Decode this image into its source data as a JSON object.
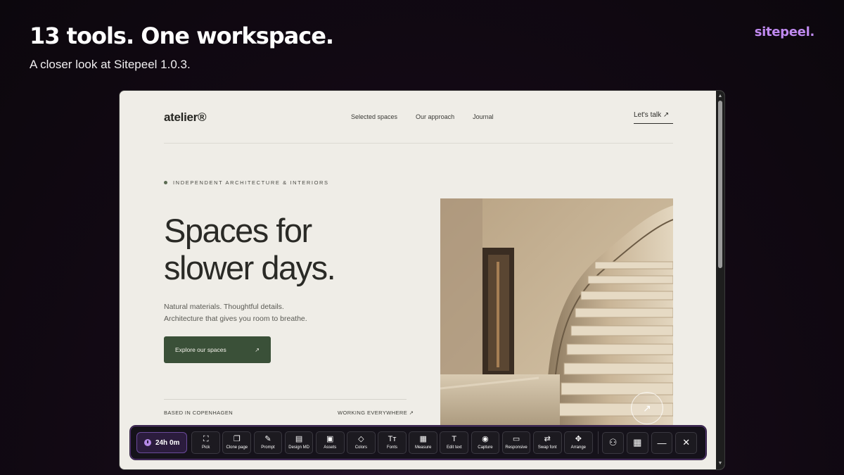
{
  "header": {
    "headline": "13 tools. One workspace.",
    "subline": "A closer look at Sitepeel 1.0.3.",
    "brand": "sitepeel."
  },
  "site": {
    "logo": "atelier®",
    "nav": [
      "Selected spaces",
      "Our approach",
      "Journal"
    ],
    "talk_link": "Let's talk ↗",
    "eyebrow": "INDEPENDENT ARCHITECTURE & INTERIORS",
    "hero_title": "Spaces for slower days.",
    "hero_text_1": "Natural materials. Thoughtful details.",
    "hero_text_2": "Architecture that gives you room to breathe.",
    "cta_label": "Explore our spaces",
    "cta_arrow": "↗",
    "footer_left": "BASED IN COPENHAGEN",
    "footer_right": "WORKING EVERYWHERE ↗",
    "image_button": "↗"
  },
  "toolbar": {
    "timer": "24h 0m",
    "tools": [
      {
        "label": "Pick",
        "icon": "⛶"
      },
      {
        "label": "Clone page",
        "icon": "❐"
      },
      {
        "label": "Prompt",
        "icon": "✎"
      },
      {
        "label": "Design MD",
        "icon": "▤"
      },
      {
        "label": "Assets",
        "icon": "▣"
      },
      {
        "label": "Colors",
        "icon": "◇"
      },
      {
        "label": "Fonts",
        "icon": "Tт"
      },
      {
        "label": "Measure",
        "icon": "▦"
      },
      {
        "label": "Edit text",
        "icon": "T"
      },
      {
        "label": "Capture",
        "icon": "◉"
      },
      {
        "label": "Responsive",
        "icon": "▭"
      },
      {
        "label": "Swap font",
        "icon": "⇄"
      },
      {
        "label": "Arrange",
        "icon": "✥"
      }
    ],
    "actions": [
      {
        "icon": "⚇"
      },
      {
        "icon": "▦"
      },
      {
        "icon": "—"
      },
      {
        "icon": "✕"
      }
    ]
  },
  "colors": {
    "brand_accent": "#c08af0",
    "cta_green": "#3a5038",
    "toolbar_border": "#5a3a7a"
  }
}
